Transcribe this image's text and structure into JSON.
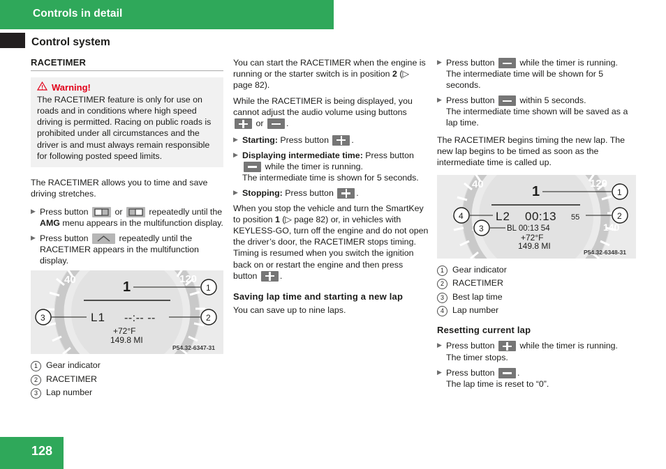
{
  "header": {
    "chapter_title": "Controls in detail",
    "section_title": "Control system",
    "accent_color": "#2fa85a",
    "tab_color": "#231f20"
  },
  "footer": {
    "page_number": "128"
  },
  "column_left": {
    "subhead": "RACETIMER",
    "warning": {
      "icon": "warning-triangle-icon",
      "label": "Warning!",
      "color": "#e2001a",
      "text": "The RACETIMER feature is only for use on roads and in conditions where high speed driving is permitted. Racing on public roads is prohibited under all circumstances and the driver is and must always remain responsible for following posted speed limits."
    },
    "intro": "The RACETIMER allows you to time and save driving stretches.",
    "step1": {
      "a": "Press button",
      "b": "or",
      "c": "repeatedly until the",
      "bold": "AMG",
      "d": "menu appears in the multifunction display."
    },
    "step2": {
      "a": "Press button",
      "b": "repeatedly until the RACETIMER appears in the multifunction display."
    },
    "figure": {
      "caption_id": "P54.32-6347-31",
      "gear": "1",
      "lap_label": "L1",
      "time": "--:-- --",
      "temp": "+72°F",
      "odo": "149.8 MI",
      "tick_left": "40",
      "tick_right": "120"
    },
    "legend": [
      {
        "num": "①",
        "label": "Gear indicator"
      },
      {
        "num": "②",
        "label": "RACETIMER"
      },
      {
        "num": "③",
        "label": "Lap number"
      }
    ]
  },
  "column_middle": {
    "p1": "You can start the RACETIMER when the engine is running or the starter switch is in position",
    "p1_bold": "2",
    "p1_ref": "(▷ page 82).",
    "p2a": "While the RACETIMER is being displayed, you cannot adjust the audio volume using buttons",
    "p2_or": "or",
    "p2_end": ".",
    "step_starting_label": "Starting:",
    "step_starting_text": "Press button",
    "step_intermediate_label": "Displaying intermediate time:",
    "step_intermediate_text1": "Press button",
    "step_intermediate_text2": "while the timer is running.",
    "step_intermediate_sub": "The intermediate time is shown for 5 seconds.",
    "step_stopping_label": "Stopping:",
    "step_stopping_text": "Press button",
    "p3a": "When you stop the vehicle and turn the SmartKey to position",
    "p3_bold": "1",
    "p3_ref": "(▷ page 82)",
    "p3b": "or, in vehicles with KEYLESS-GO, turn off the engine and do not open the driver’s door, the RACETIMER stops timing. Timing is resumed when you switch the ignition back on or restart the engine and then press button",
    "p3_end": ".",
    "subhead2": "Saving lap time and starting a new lap",
    "p4": "You can save up to nine laps."
  },
  "column_right": {
    "step1a": "Press button",
    "step1b": "while the timer is running.",
    "step1sub": "The intermediate time will be shown for 5 seconds.",
    "step2a": "Press button",
    "step2b": "within 5 seconds.",
    "step2sub": "The intermediate time shown will be saved as a lap time.",
    "p1": "The RACETIMER begins timing the new lap. The new lap begins to be timed as soon as the intermediate time is called up.",
    "figure": {
      "caption_id": "P54.32-6348-31",
      "gear": "1",
      "lap_label": "L2",
      "time": "00:13",
      "time_hundredths": "55",
      "best_prefix": "BL",
      "best_time": "00:13 54",
      "temp": "+72°F",
      "odo": "149.8 MI",
      "tick_left": "40",
      "tick_right": "120"
    },
    "legend": [
      {
        "num": "①",
        "label": "Gear indicator"
      },
      {
        "num": "②",
        "label": "RACETIMER"
      },
      {
        "num": "③",
        "label": "Best lap time"
      },
      {
        "num": "④",
        "label": "Lap number"
      }
    ],
    "subhead": "Resetting current lap",
    "step3a": "Press button",
    "step3b": "while the timer is running.",
    "step3sub": "The timer stops.",
    "step4a": "Press button",
    "step4b": ".",
    "step4sub": "The lap time is reset to “0”."
  },
  "icons": {
    "plus_button": "plus-button-icon",
    "minus_button": "minus-button-icon",
    "display_left_button": "display-scroll-left-button-icon",
    "display_right_button": "display-scroll-right-button-icon",
    "up_button": "up-arrow-button-icon",
    "arrow_bullet": "▶"
  }
}
